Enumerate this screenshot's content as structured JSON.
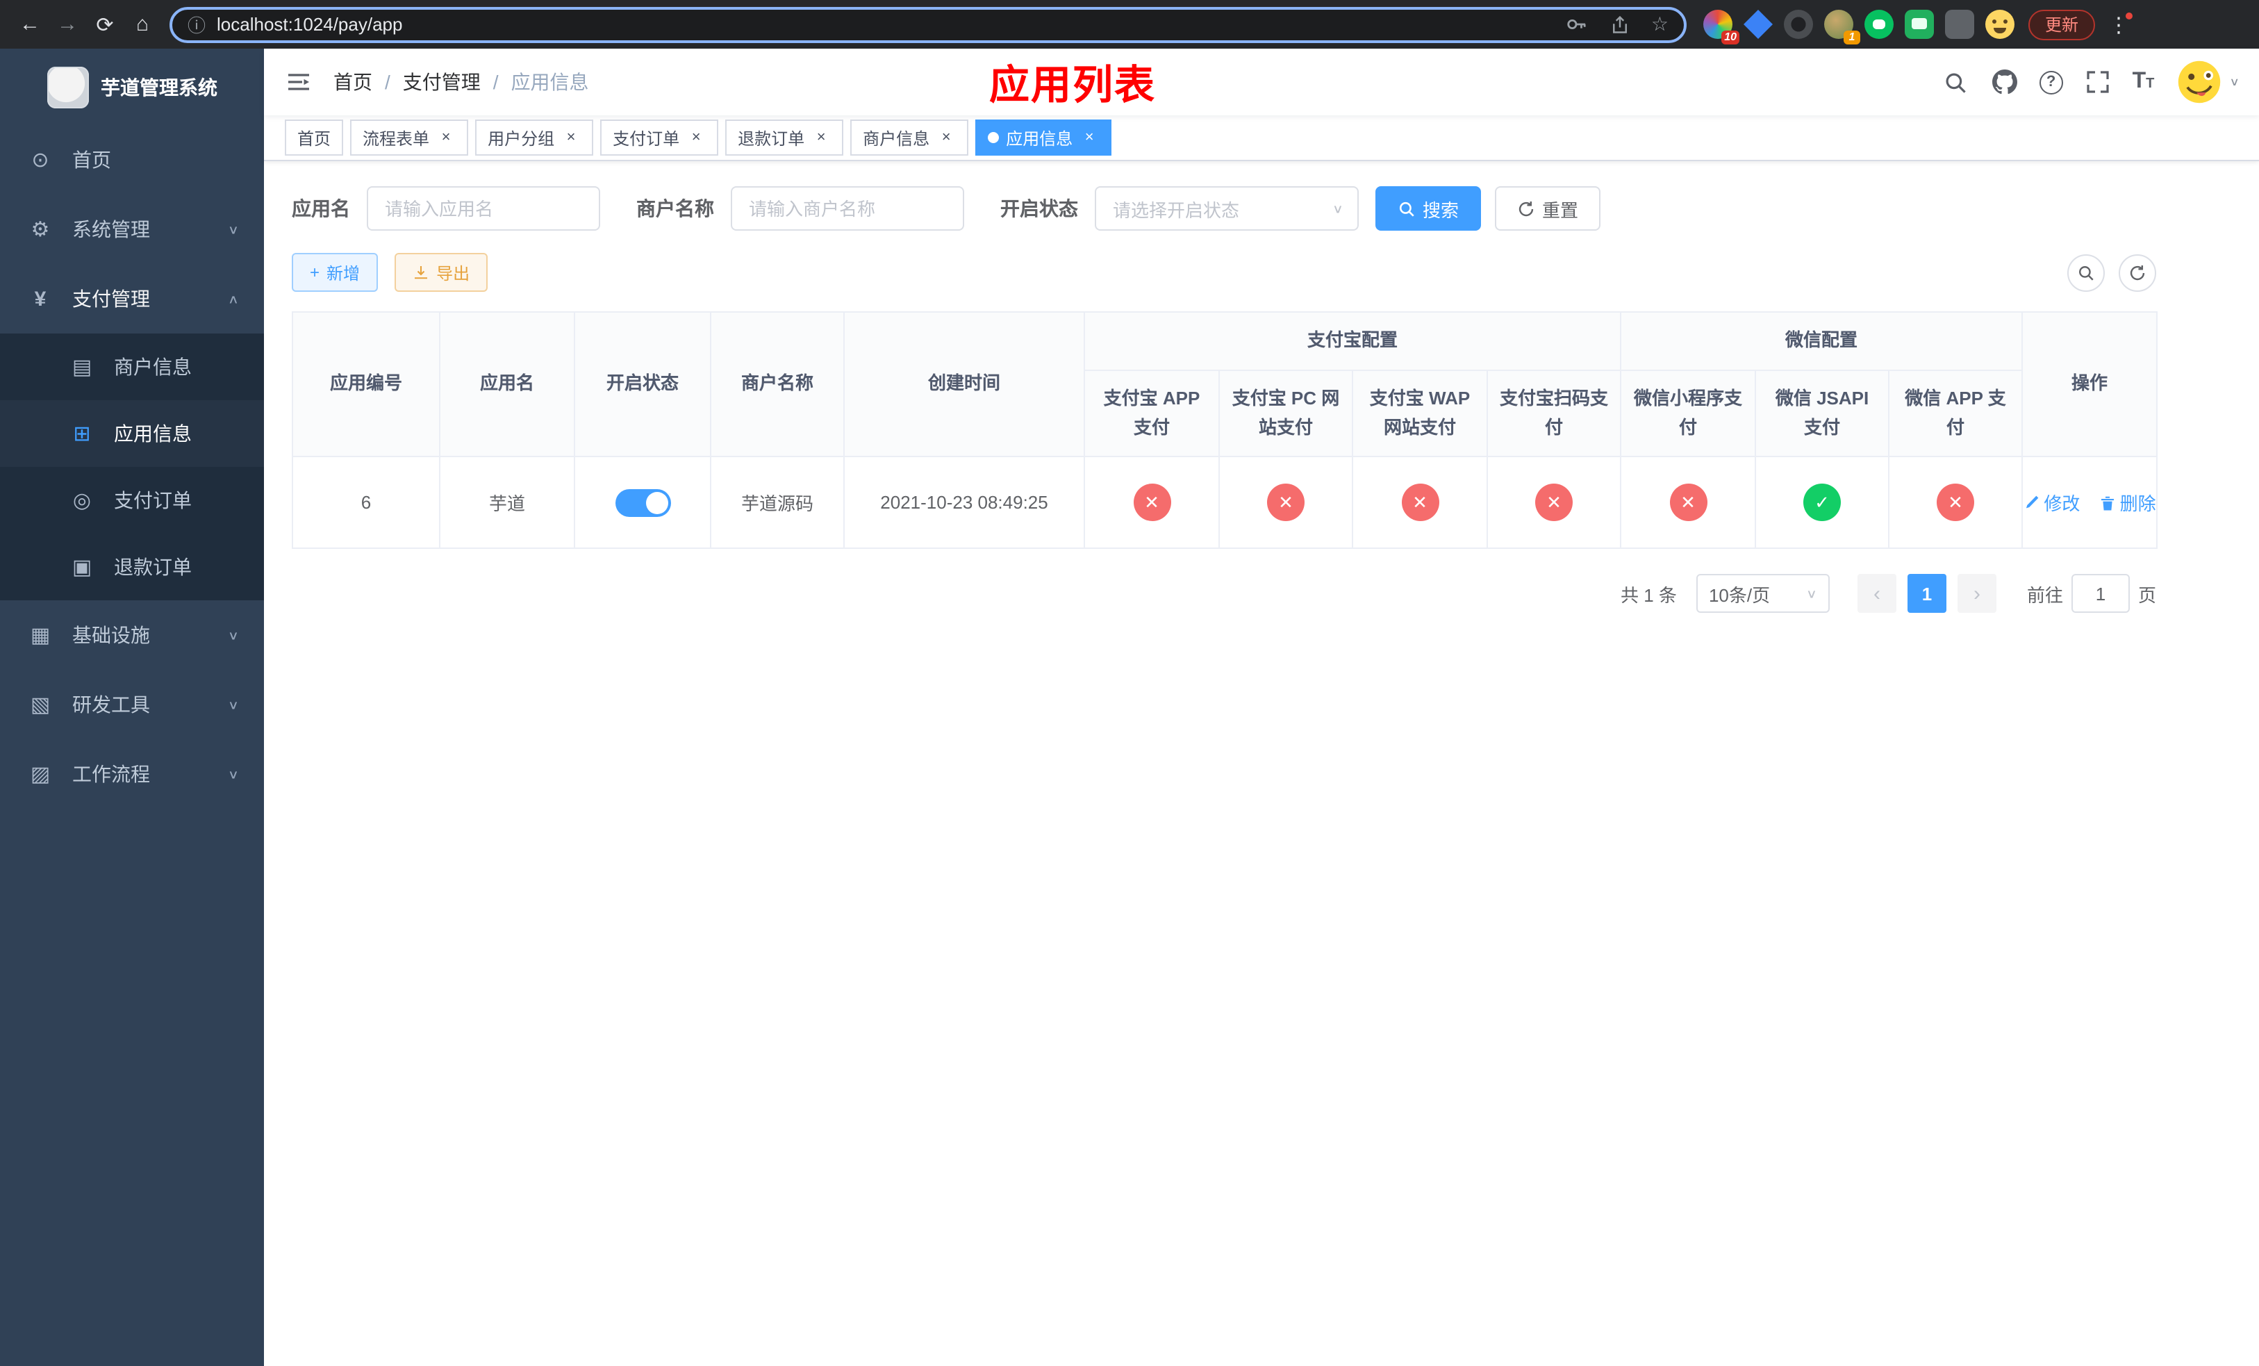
{
  "browser": {
    "url": "localhost:1024/pay/app",
    "update_label": "更新",
    "ext_badge_pin": "10",
    "ext_badge_profile": "1"
  },
  "icons": {
    "back": "←",
    "forward": "→",
    "reload": "⟳",
    "home": "⌂",
    "info": "ⓘ",
    "star": "☆",
    "dots": "⋮",
    "close": "×",
    "chevron_down": "∨",
    "chevron_up": "∧",
    "plus": "+",
    "question": "?",
    "prev": "‹",
    "next": "›",
    "slash": "/"
  },
  "sidebar": {
    "title": "芋道管理系统",
    "items": [
      {
        "label": "首页",
        "glyph": "⊙",
        "arrow": ""
      },
      {
        "label": "系统管理",
        "glyph": "⚙",
        "arrow": "∨"
      },
      {
        "label": "支付管理",
        "glyph": "¥",
        "arrow": "∧"
      },
      {
        "label": "基础设施",
        "glyph": "▦",
        "arrow": "∨"
      },
      {
        "label": "研发工具",
        "glyph": "▧",
        "arrow": "∨"
      },
      {
        "label": "工作流程",
        "glyph": "▨",
        "arrow": "∨"
      }
    ],
    "submenu": [
      {
        "label": "商户信息",
        "glyph": "▤"
      },
      {
        "label": "应用信息",
        "glyph": "⊞"
      },
      {
        "label": "支付订单",
        "glyph": "◎"
      },
      {
        "label": "退款订单",
        "glyph": "▣"
      }
    ]
  },
  "header": {
    "breadcrumb": [
      "首页",
      "支付管理",
      "应用信息"
    ],
    "page_title": "应用列表"
  },
  "tabs": [
    {
      "label": "首页"
    },
    {
      "label": "流程表单"
    },
    {
      "label": "用户分组"
    },
    {
      "label": "支付订单"
    },
    {
      "label": "退款订单"
    },
    {
      "label": "商户信息"
    },
    {
      "label": "应用信息"
    }
  ],
  "filters": {
    "app_name_label": "应用名",
    "app_name_placeholder": "请输入应用名",
    "merchant_label": "商户名称",
    "merchant_placeholder": "请输入商户名称",
    "status_label": "开启状态",
    "status_placeholder": "请选择开启状态",
    "search_label": "搜索",
    "reset_label": "重置"
  },
  "toolbar": {
    "add_label": "新增",
    "export_label": "导出"
  },
  "table": {
    "group_alipay": "支付宝配置",
    "group_wechat": "微信配置",
    "cols": {
      "id": "应用编号",
      "name": "应用名",
      "status": "开启状态",
      "merchant": "商户名称",
      "created": "创建时间",
      "alipay_app": "支付宝 APP 支付",
      "alipay_pc": "支付宝 PC 网站支付",
      "alipay_wap": "支付宝 WAP 网站支付",
      "alipay_qr": "支付宝扫码支付",
      "wx_mini": "微信小程序支付",
      "wx_jsapi": "微信 JSAPI 支付",
      "wx_app": "微信 APP 支付",
      "actions": "操作"
    },
    "rows": [
      {
        "id": "6",
        "name": "芋道",
        "enabled": true,
        "merchant": "芋道源码",
        "created": "2021-10-23 08:49:25",
        "channels": [
          "no",
          "no",
          "no",
          "no",
          "no",
          "yes",
          "no"
        ],
        "edit_label": "修改",
        "delete_label": "删除"
      }
    ]
  },
  "pagination": {
    "total_text": "共 1 条",
    "page_size": "10条/页",
    "current_page": "1",
    "goto_prefix": "前往",
    "goto_value": "1",
    "goto_suffix": "页"
  }
}
